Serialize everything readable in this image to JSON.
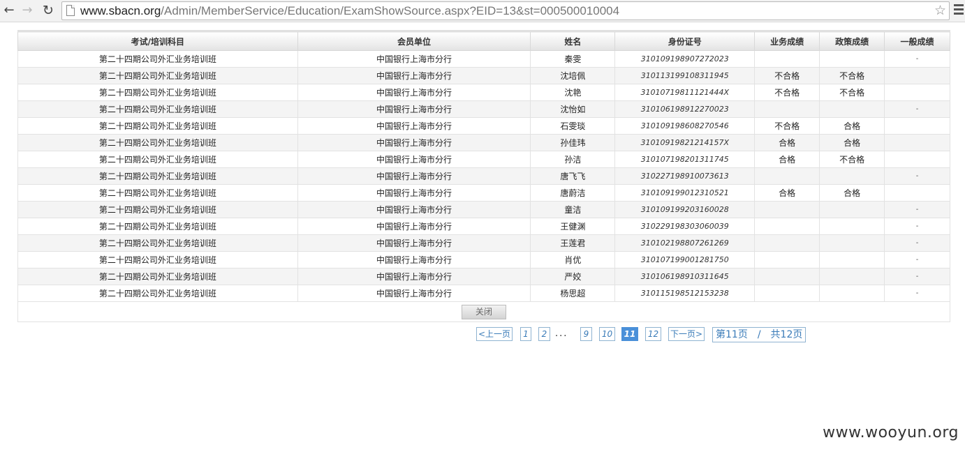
{
  "browser": {
    "url_host": "www.sbacn.org",
    "url_path": "/Admin/MemberService/Education/ExamShowSource.aspx?EID=13&st=000500010004"
  },
  "table": {
    "headers": [
      "考试/培训科目",
      "会员单位",
      "姓名",
      "身份证号",
      "业务成绩",
      "政策成绩",
      "一般成绩"
    ],
    "rows": [
      [
        "第二十四期公司外汇业务培训班",
        "中国银行上海市分行",
        "秦雯",
        "310109198907272023",
        "",
        "",
        "-"
      ],
      [
        "第二十四期公司外汇业务培训班",
        "中国银行上海市分行",
        "沈培佩",
        "310113199108311945",
        "不合格",
        "不合格",
        ""
      ],
      [
        "第二十四期公司外汇业务培训班",
        "中国银行上海市分行",
        "沈艳",
        "31010719811121444X",
        "不合格",
        "不合格",
        ""
      ],
      [
        "第二十四期公司外汇业务培训班",
        "中国银行上海市分行",
        "沈怡如",
        "310106198912270023",
        "",
        "",
        "-"
      ],
      [
        "第二十四期公司外汇业务培训班",
        "中国银行上海市分行",
        "石雯琰",
        "310109198608270546",
        "不合格",
        "合格",
        ""
      ],
      [
        "第二十四期公司外汇业务培训班",
        "中国银行上海市分行",
        "孙佳玮",
        "31010919821214157X",
        "合格",
        "合格",
        ""
      ],
      [
        "第二十四期公司外汇业务培训班",
        "中国银行上海市分行",
        "孙洁",
        "310107198201311745",
        "合格",
        "不合格",
        ""
      ],
      [
        "第二十四期公司外汇业务培训班",
        "中国银行上海市分行",
        "唐飞飞",
        "310227198910073613",
        "",
        "",
        "-"
      ],
      [
        "第二十四期公司外汇业务培训班",
        "中国银行上海市分行",
        "唐蔚洁",
        "310109199012310521",
        "合格",
        "合格",
        ""
      ],
      [
        "第二十四期公司外汇业务培训班",
        "中国银行上海市分行",
        "童洁",
        "310109199203160028",
        "",
        "",
        "-"
      ],
      [
        "第二十四期公司外汇业务培训班",
        "中国银行上海市分行",
        "王健渊",
        "310229198303060039",
        "",
        "",
        "-"
      ],
      [
        "第二十四期公司外汇业务培训班",
        "中国银行上海市分行",
        "王莲君",
        "310102198807261269",
        "",
        "",
        "-"
      ],
      [
        "第二十四期公司外汇业务培训班",
        "中国银行上海市分行",
        "肖优",
        "310107199001281750",
        "",
        "",
        "-"
      ],
      [
        "第二十四期公司外汇业务培训班",
        "中国银行上海市分行",
        "严姣",
        "310106198910311645",
        "",
        "",
        "-"
      ],
      [
        "第二十四期公司外汇业务培训班",
        "中国银行上海市分行",
        "杨思超",
        "310115198512153238",
        "",
        "",
        "-"
      ]
    ]
  },
  "close_label": "关闭",
  "pager": {
    "prev_label": "<上一页",
    "pages": [
      "1",
      "2",
      "9",
      "10",
      "11",
      "12"
    ],
    "ellipsis": "...",
    "current": "11",
    "next_label": "下一页>",
    "info": "第11页　/　共12页"
  },
  "watermark": "www.wooyun.org"
}
